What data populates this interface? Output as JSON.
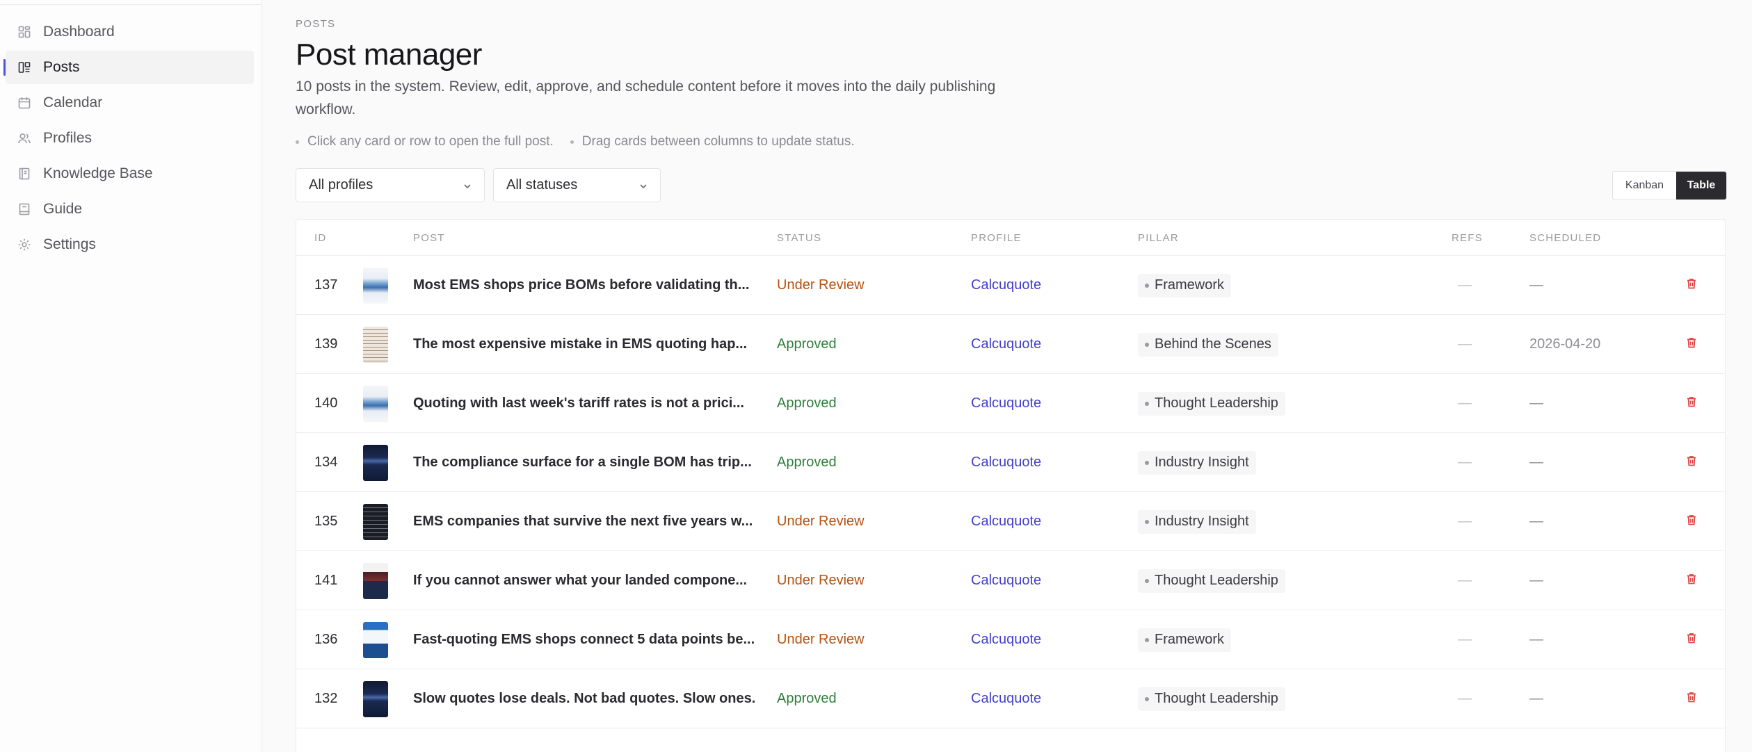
{
  "nav": [
    {
      "label": "Dashboard",
      "icon": "dashboard-icon",
      "active": false
    },
    {
      "label": "Posts",
      "icon": "posts-icon",
      "active": true
    },
    {
      "label": "Calendar",
      "icon": "calendar-icon",
      "active": false
    },
    {
      "label": "Profiles",
      "icon": "profiles-icon",
      "active": false
    },
    {
      "label": "Knowledge Base",
      "icon": "book-icon",
      "active": false
    },
    {
      "label": "Guide",
      "icon": "guide-icon",
      "active": false
    },
    {
      "label": "Settings",
      "icon": "gear-icon",
      "active": false
    }
  ],
  "header": {
    "eyebrow": "POSTS",
    "title": "Post manager",
    "description": "10 posts in the system. Review, edit, approve, and schedule content before it moves into the daily publishing workflow.",
    "hints": [
      "Click any card or row to open the full post.",
      "Drag cards between columns to update status."
    ]
  },
  "filters": {
    "profiles": "All profiles",
    "statuses": "All statuses"
  },
  "view_toggle": {
    "kanban": "Kanban",
    "table": "Table",
    "selected": "Table"
  },
  "table": {
    "columns": {
      "id": "ID",
      "post": "POST",
      "status": "STATUS",
      "profile": "PROFILE",
      "pillar": "PILLAR",
      "refs": "REFS",
      "scheduled": "SCHEDULED"
    },
    "rows": [
      {
        "id": "137",
        "post": "Most EMS shops price BOMs before validating th...",
        "status": "Under Review",
        "profile": "Calcuquote",
        "pillar": "Framework",
        "refs": "—",
        "scheduled": "—",
        "thumb": "light"
      },
      {
        "id": "139",
        "post": "The most expensive mistake in EMS quoting hap...",
        "status": "Approved",
        "profile": "Calcuquote",
        "pillar": "Behind the Scenes",
        "refs": "—",
        "scheduled": "2026-04-20",
        "thumb": "paper"
      },
      {
        "id": "140",
        "post": "Quoting with last week's tariff rates is not a prici...",
        "status": "Approved",
        "profile": "Calcuquote",
        "pillar": "Thought Leadership",
        "refs": "—",
        "scheduled": "—",
        "thumb": "light"
      },
      {
        "id": "134",
        "post": "The compliance surface for a single BOM has trip...",
        "status": "Approved",
        "profile": "Calcuquote",
        "pillar": "Industry Insight",
        "refs": "—",
        "scheduled": "—",
        "thumb": "navy"
      },
      {
        "id": "135",
        "post": "EMS companies that survive the next five years w...",
        "status": "Under Review",
        "profile": "Calcuquote",
        "pillar": "Industry Insight",
        "refs": "—",
        "scheduled": "—",
        "thumb": "dark"
      },
      {
        "id": "141",
        "post": "If you cannot answer what your landed compone...",
        "status": "Under Review",
        "profile": "Calcuquote",
        "pillar": "Thought Leadership",
        "refs": "—",
        "scheduled": "—",
        "thumb": "redband"
      },
      {
        "id": "136",
        "post": "Fast-quoting EMS shops connect 5 data points be...",
        "status": "Under Review",
        "profile": "Calcuquote",
        "pillar": "Framework",
        "refs": "—",
        "scheduled": "—",
        "thumb": "blue"
      },
      {
        "id": "132",
        "post": "Slow quotes lose deals. Not bad quotes. Slow ones.",
        "status": "Approved",
        "profile": "Calcuquote",
        "pillar": "Thought Leadership",
        "refs": "—",
        "scheduled": "—",
        "thumb": "navy"
      }
    ]
  },
  "colors": {
    "accent": "#4c52d9",
    "under_review": "#b5520e",
    "approved": "#2f7d3a",
    "profile_link": "#4440cc",
    "delete": "#e04848"
  }
}
